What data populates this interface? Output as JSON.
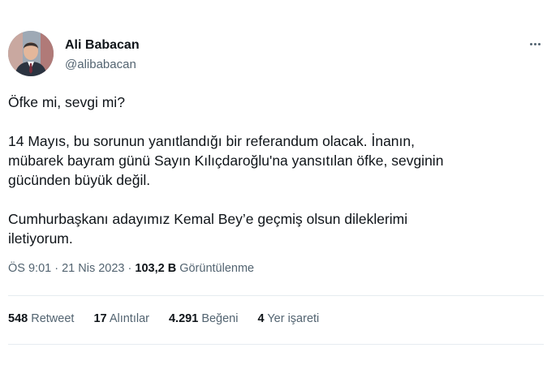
{
  "user": {
    "name": "Ali Babacan",
    "handle": "@alibabacan"
  },
  "tweet": {
    "paragraphs": [
      "Öfke mi, sevgi mi?",
      "14 Mayıs, bu sorunun yanıtlandığı bir referandum olacak. İnanın,\nmübarek bayram günü Sayın Kılıçdaroğlu'na yansıtılan öfke, sevginin\ngücünden büyük değil.",
      "Cumhurbaşkanı adayımız Kemal Bey’e geçmiş olsun dileklerimi\niletiyorum."
    ]
  },
  "meta": {
    "time": "ÖS 9:01",
    "separator": " · ",
    "date": "21 Nis 2023",
    "views_count": "103,2 B",
    "views_label": "Görüntülenme"
  },
  "stats": {
    "retweets_count": "548",
    "retweets_label": "Retweet",
    "quotes_count": "17",
    "quotes_label": "Alıntılar",
    "likes_count": "4.291",
    "likes_label": "Beğeni",
    "bookmarks_count": "4",
    "bookmarks_label": "Yer işareti"
  },
  "icons": {
    "more": "more-horizontal-icon"
  },
  "colors": {
    "primary_text": "#0f1419",
    "secondary_text": "#536471",
    "divider": "#e6ecf0"
  }
}
